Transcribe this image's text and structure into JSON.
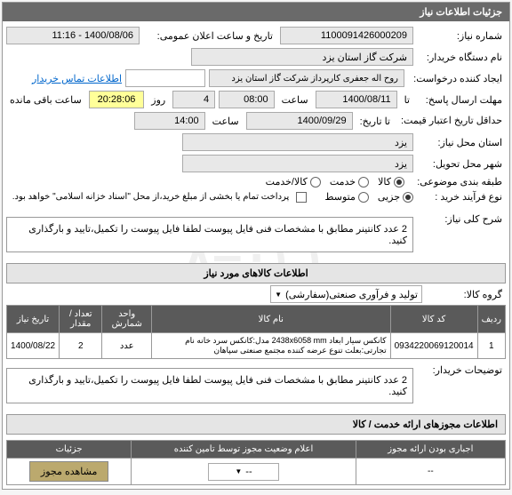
{
  "main_panel": {
    "title": "جزئیات اطلاعات نیاز"
  },
  "form": {
    "need_no_label": "شماره نیاز:",
    "need_no": "1100091426000209",
    "announce_dt_label": "تاریخ و ساعت اعلان عمومی:",
    "announce_dt": "1400/08/06 - 11:16",
    "buyer_label": "نام دستگاه خریدار:",
    "buyer": "شرکت گاز استان یزد",
    "requester_label": "ایجاد کننده درخواست:",
    "requester": "روح‌ اله جعفری کارپرداز شرکت گاز استان یزد",
    "contact_link": "اطلاعات تماس خریدار",
    "reply_deadline_label": "مهلت ارسال پاسخ:",
    "reply_to_label": "تا",
    "reply_date": "1400/08/11",
    "time_label": "ساعت",
    "reply_time": "08:00",
    "day_label": "روز",
    "days": "4",
    "remaining_time": "20:28:06",
    "remaining_label": "ساعت باقی مانده",
    "min_valid_label": "حداقل تاریخ اعتبار قیمت:",
    "to_date_label": "تا تاریخ:",
    "min_valid_date": "1400/09/29",
    "min_valid_time": "14:00",
    "need_place_label": "استان محل نیاز:",
    "place_value": "یزد",
    "delivery_city_label": "شهر محل تحویل:",
    "classification_label": "طبقه بندی موضوعی:",
    "cls_goods": "کالا",
    "cls_service": "خدمت",
    "cls_both": "کالا/خدمت",
    "purchase_type_label": "نوع فرآیند خرید :",
    "pt_partial": "جزیی",
    "pt_medium": "متوسط",
    "payment_note": "پرداخت تمام یا بخشی از مبلغ خرید،از محل \"اسناد خزانه اسلامی\" خواهد بود.",
    "general_desc_label": "شرح کلی نیاز:",
    "general_desc": "2 عدد کانتینر مطابق با مشخصات فنی فایل پیوست لطفا فایل پیوست را تکمیل،تایید و بارگذاری کنید."
  },
  "goods_section": {
    "title": "اطلاعات کالاهای مورد نیاز",
    "group_label": "گروه کالا:",
    "group_value": "تولید و فرآوری صنعتی(سفارشی)",
    "headers": {
      "row": "ردیف",
      "code": "کد کالا",
      "name": "نام کالا",
      "unit": "واحد شمارش",
      "qty": "تعداد / مقدار",
      "date": "تاریخ نیاز"
    },
    "rows": [
      {
        "idx": "1",
        "code": "0934220069120014",
        "name": "کانکس سیار ابعاد 2438x6058 mm مدل:کانکس سرد خانه نام تجارتی:بعلت تنوع عرضه کننده مجتمع صنعتی سپاهان",
        "unit": "عدد",
        "qty": "2",
        "date": "1400/08/22"
      }
    ],
    "buyer_notes_label": "توضیحات خریدار:",
    "buyer_notes": "2 عدد کانتینر مطابق با مشخصات فنی فایل پیوست لطفا فایل پیوست را تکمیل،تایید و بارگذاری کنید."
  },
  "license_section": {
    "title": "اطلاعات مجوزهای ارائه خدمت / کالا",
    "headers": {
      "mandatory": "اجباری بودن ارائه مجوز",
      "supplier_status": "اعلام وضعیت مجوز توسط تامین کننده",
      "details": "جزئیات"
    },
    "row": {
      "mandatory": "--",
      "supplier_status": "--",
      "button": "مشاهده مجوز"
    }
  }
}
